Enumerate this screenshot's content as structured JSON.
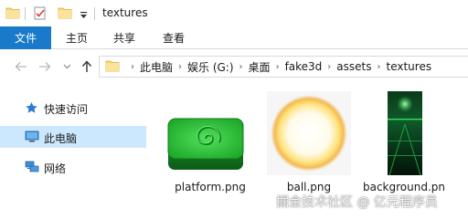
{
  "window": {
    "title": "textures"
  },
  "ribbon": {
    "tabs": [
      {
        "label": "文件"
      },
      {
        "label": "主页"
      },
      {
        "label": "共享"
      },
      {
        "label": "查看"
      }
    ]
  },
  "address": {
    "crumbs": [
      "此电脑",
      "娱乐 (G:)",
      "桌面",
      "fake3d",
      "assets",
      "textures"
    ]
  },
  "navpane": {
    "items": [
      {
        "label": "快速访问",
        "icon": "star-icon"
      },
      {
        "label": "此电脑",
        "icon": "computer-icon",
        "selected": true
      },
      {
        "label": "网络",
        "icon": "network-icon"
      }
    ]
  },
  "files": [
    {
      "name": "platform.png",
      "thumb": "platform-thumbnail"
    },
    {
      "name": "ball.png",
      "thumb": "ball-thumbnail"
    },
    {
      "name": "background.pn",
      "thumb": "background-thumbnail"
    }
  ],
  "watermark": {
    "text": "掘金技术社区 @ 亿元程序员"
  },
  "colors": {
    "accent": "#1979ca",
    "selection": "#cce8ff",
    "folder": "#f8d775"
  }
}
